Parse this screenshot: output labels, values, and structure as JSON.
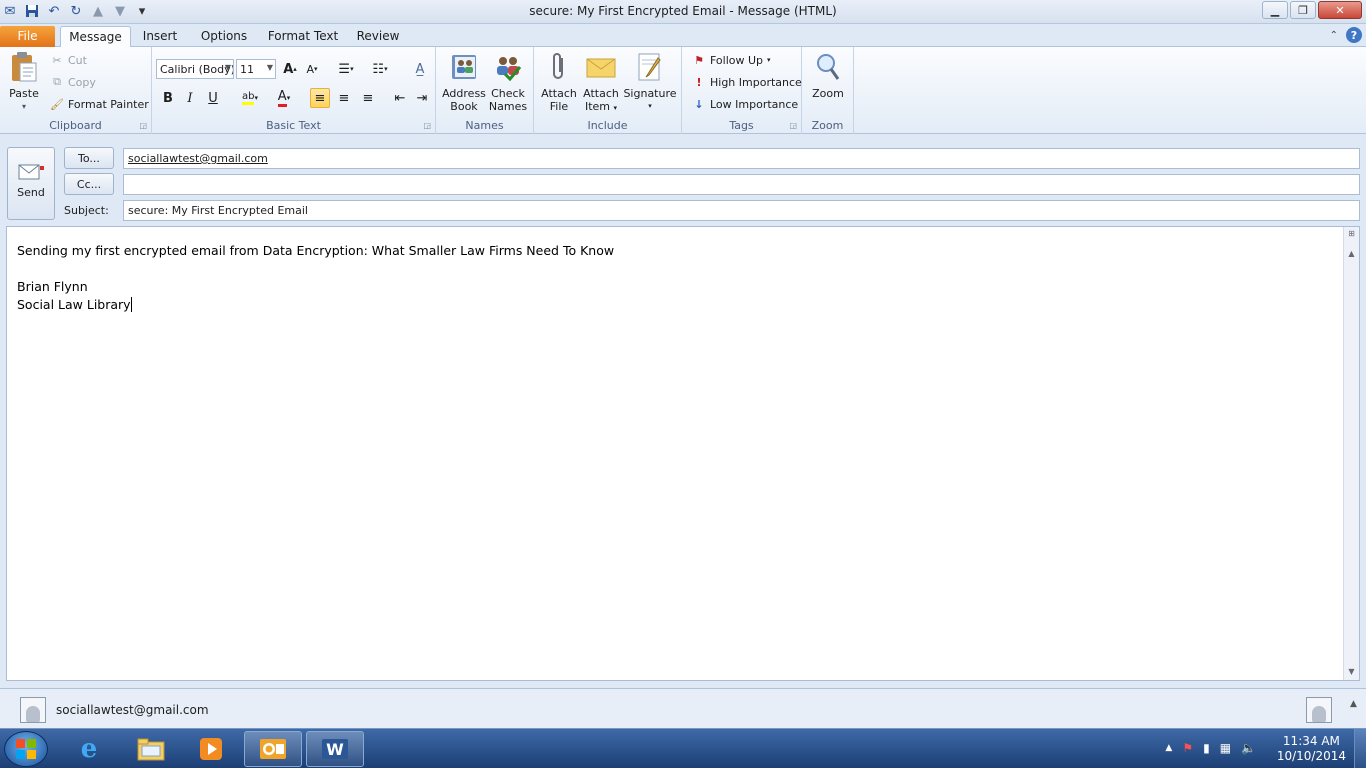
{
  "window": {
    "title": "secure:  My First Encrypted Email  -  Message (HTML)"
  },
  "qat_icons": [
    "email-icon",
    "save-icon",
    "undo-icon",
    "redo-icon",
    "up-arrow-icon",
    "down-arrow-icon",
    "customize-qat-icon"
  ],
  "tabs": [
    {
      "label": "File"
    },
    {
      "label": "Message"
    },
    {
      "label": "Insert"
    },
    {
      "label": "Options"
    },
    {
      "label": "Format Text"
    },
    {
      "label": "Review"
    }
  ],
  "ribbon": {
    "clipboard": {
      "label": "Clipboard",
      "paste": "Paste",
      "cut": "Cut",
      "copy": "Copy",
      "format_painter": "Format Painter"
    },
    "basic_text": {
      "label": "Basic Text",
      "font": "Calibri (Body)",
      "size": "11",
      "bold": "B",
      "italic": "I",
      "underline": "U",
      "font_color_glyph": "A",
      "highlight_glyph": "ab",
      "grow_glyph": "A",
      "shrink_glyph": "A"
    },
    "names": {
      "label": "Names",
      "address_book_l1": "Address",
      "address_book_l2": "Book",
      "check_names_l1": "Check",
      "check_names_l2": "Names"
    },
    "include": {
      "label": "Include",
      "attach_file_l1": "Attach",
      "attach_file_l2": "File",
      "attach_item_l1": "Attach",
      "attach_item_l2": "Item",
      "signature": "Signature"
    },
    "tags": {
      "label": "Tags",
      "follow_up": "Follow Up",
      "high_importance": "High Importance",
      "low_importance": "Low Importance"
    },
    "zoom": {
      "label": "Zoom",
      "zoom": "Zoom"
    }
  },
  "header": {
    "send": "Send",
    "to_button": "To...",
    "cc_button": "Cc...",
    "subject_label": "Subject:",
    "to_value": "sociallawtest@gmail.com",
    "cc_value": "",
    "subject_value": "secure:  My First Encrypted Email"
  },
  "body": {
    "line1": "Sending my first encrypted email from Data Encryption:  What Smaller Law Firms Need To Know",
    "line2": "Brian Flynn",
    "line3": "Social Law Library"
  },
  "people_pane": {
    "contact": "sociallawtest@gmail.com"
  },
  "taskbar": {
    "apps": [
      "internet-explorer-icon",
      "windows-explorer-icon",
      "media-player-icon",
      "outlook-icon",
      "word-icon"
    ],
    "time": "11:34 AM",
    "date": "10/10/2014"
  },
  "colors": {
    "file_tab": "#e2731a",
    "ribbon_bg": "#e3ecf7",
    "taskbar": "#1c3f75"
  }
}
